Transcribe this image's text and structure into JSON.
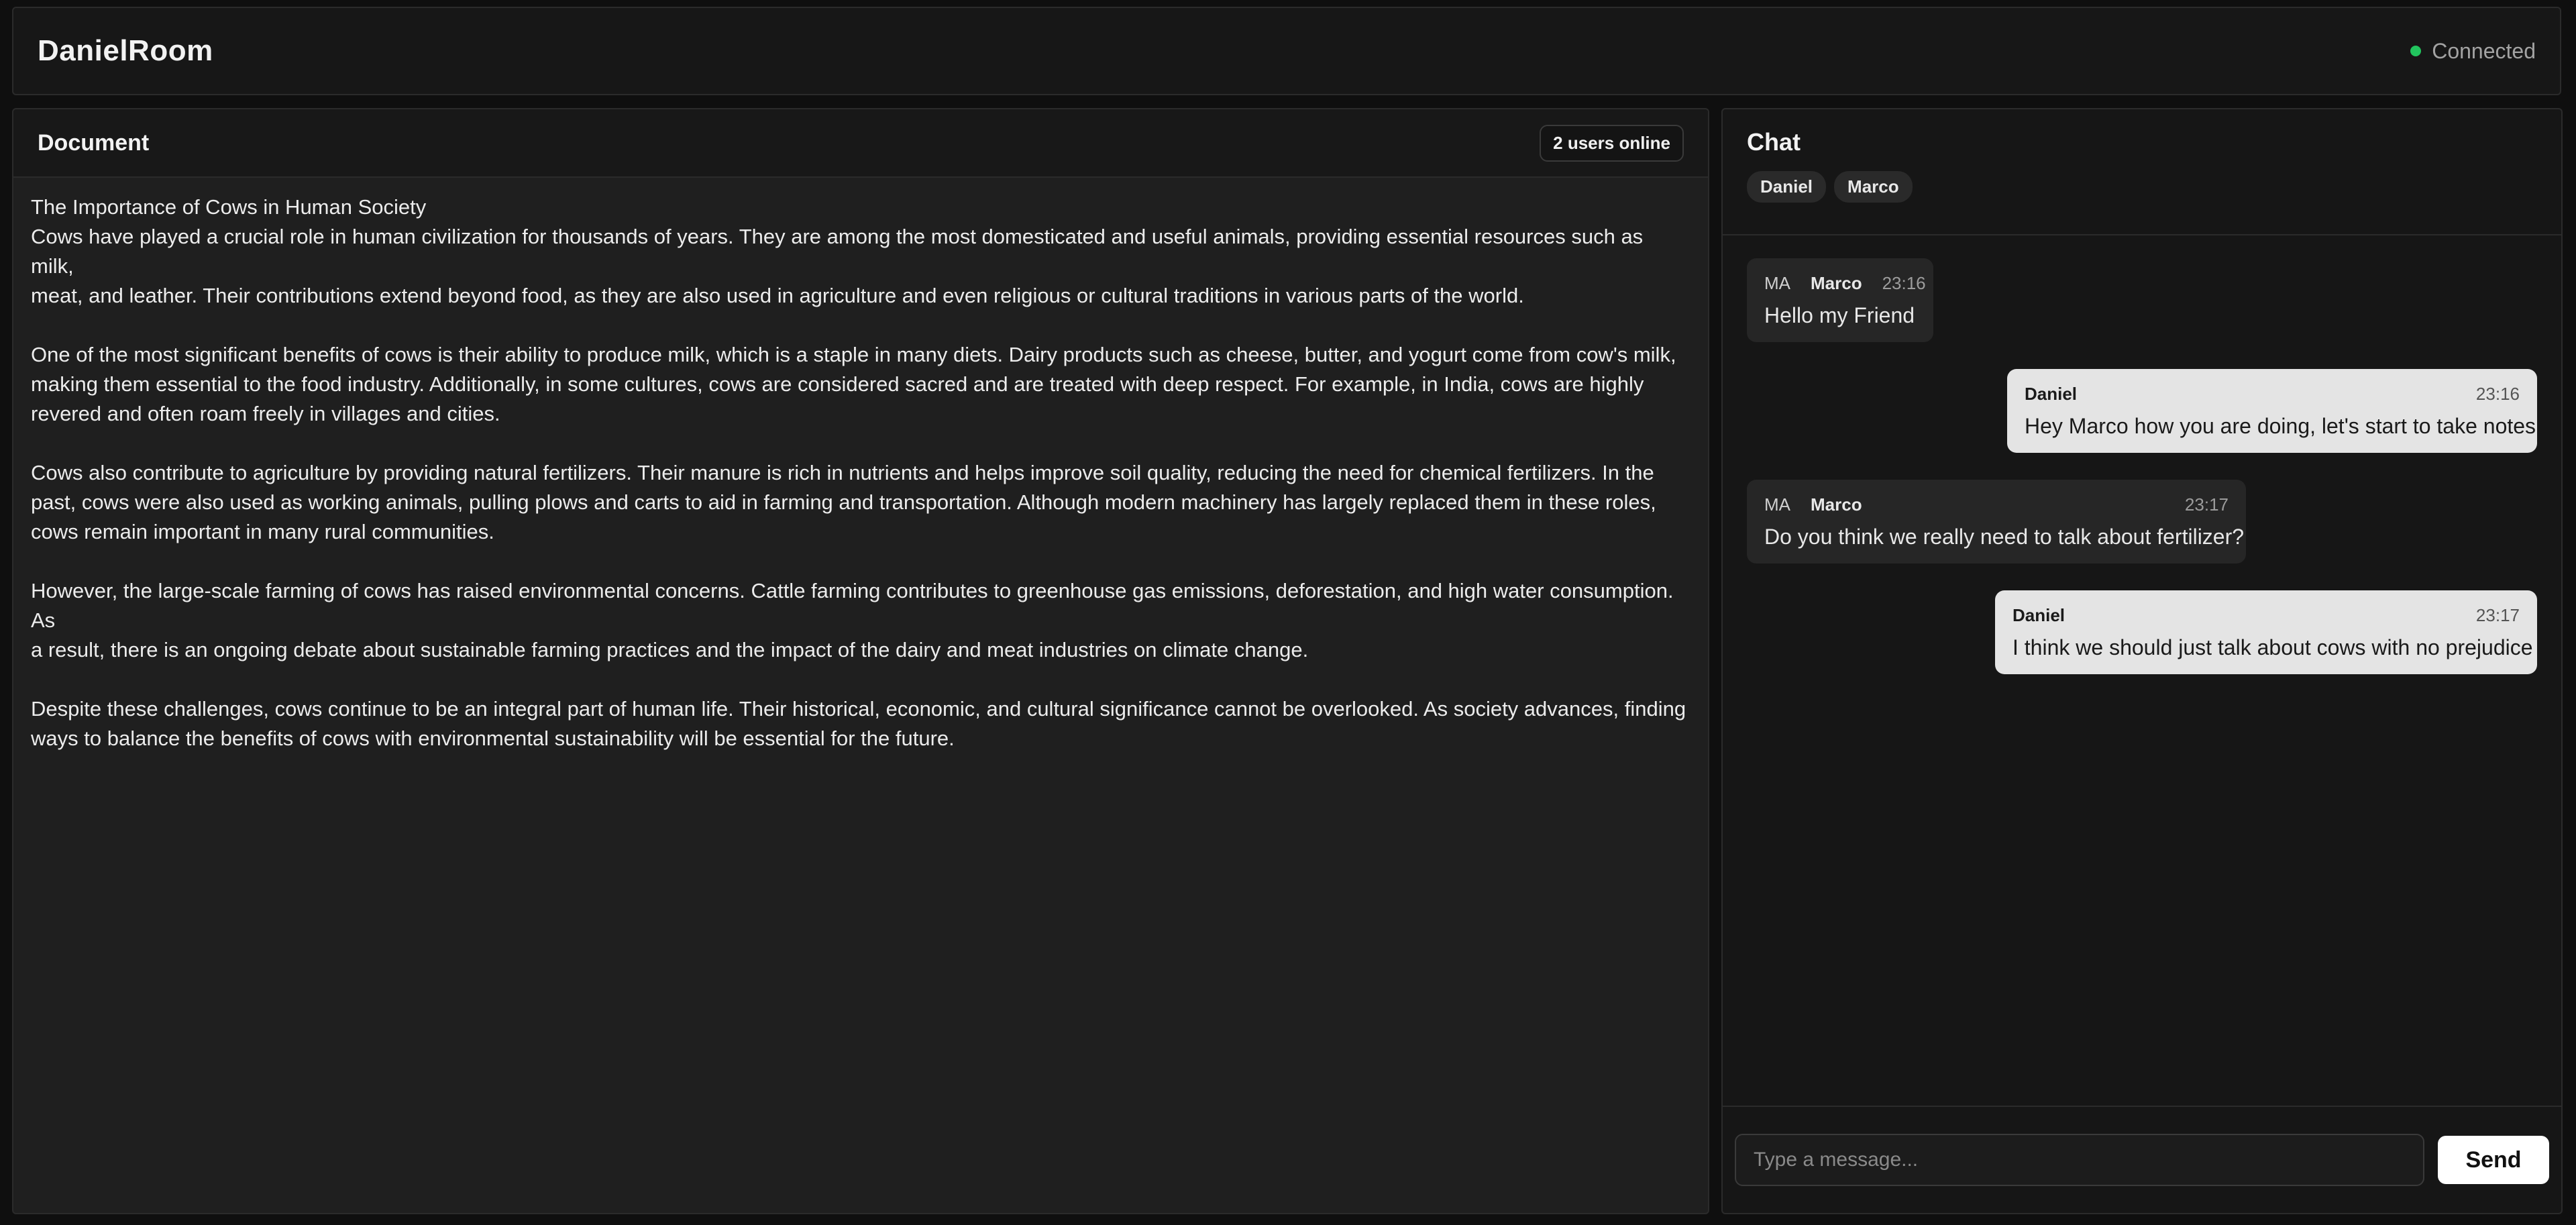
{
  "header": {
    "app_title": "DanielRoom",
    "status": "Connected",
    "status_color": "#22c55e"
  },
  "document": {
    "title": "Document",
    "online_badge": "2 users online",
    "lines": [
      "The Importance of Cows in Human Society",
      "Cows have played a crucial role in human civilization for thousands of years. They are among the most domesticated and useful animals, providing essential resources such as milk,",
      "meat, and leather. Their contributions extend beyond food, as they are also used in agriculture and even religious or cultural traditions in various parts of the world.",
      "",
      "One of the most significant benefits of cows is their ability to produce milk, which is a staple in many diets. Dairy products such as cheese, butter, and yogurt come from cow's milk,",
      "making them essential to the food industry. Additionally, in some cultures, cows are considered sacred and are treated with deep respect. For example, in India, cows are highly",
      "revered and often roam freely in villages and cities.",
      "",
      "Cows also contribute to agriculture by providing natural fertilizers. Their manure is rich in nutrients and helps improve soil quality, reducing the need for chemical fertilizers. In the",
      "past, cows were also used as working animals, pulling plows and carts to aid in farming and transportation. Although modern machinery has largely replaced them in these roles,",
      "cows remain important in many rural communities.",
      "",
      "However, the large-scale farming of cows has raised environmental concerns. Cattle farming contributes to greenhouse gas emissions, deforestation, and high water consumption. As",
      "a result, there is an ongoing debate about sustainable farming practices and the impact of the dairy and meat industries on climate change.",
      "",
      "Despite these challenges, cows continue to be an integral part of human life. Their historical, economic, and cultural significance cannot be overlooked. As society advances, finding",
      "ways to balance the benefits of cows with environmental sustainability will be essential for the future."
    ]
  },
  "chat": {
    "title": "Chat",
    "participants": [
      "Daniel",
      "Marco"
    ],
    "messages": [
      {
        "initials": "MA",
        "sender": "Marco",
        "time": "23:16",
        "text": "Hello my Friend"
      },
      {
        "initials": "",
        "sender": "Daniel",
        "time": "23:16",
        "text": "Hey Marco how you are doing, let's start to take notes"
      },
      {
        "initials": "MA",
        "sender": "Marco",
        "time": "23:17",
        "text": "Do you think we really need to talk about fertilizer?"
      },
      {
        "initials": "",
        "sender": "Daniel",
        "time": "23:17",
        "text": "I think we should just talk about cows with no prejudice"
      }
    ],
    "input_placeholder": "Type a message...",
    "input_value": "",
    "send_label": "Send"
  }
}
